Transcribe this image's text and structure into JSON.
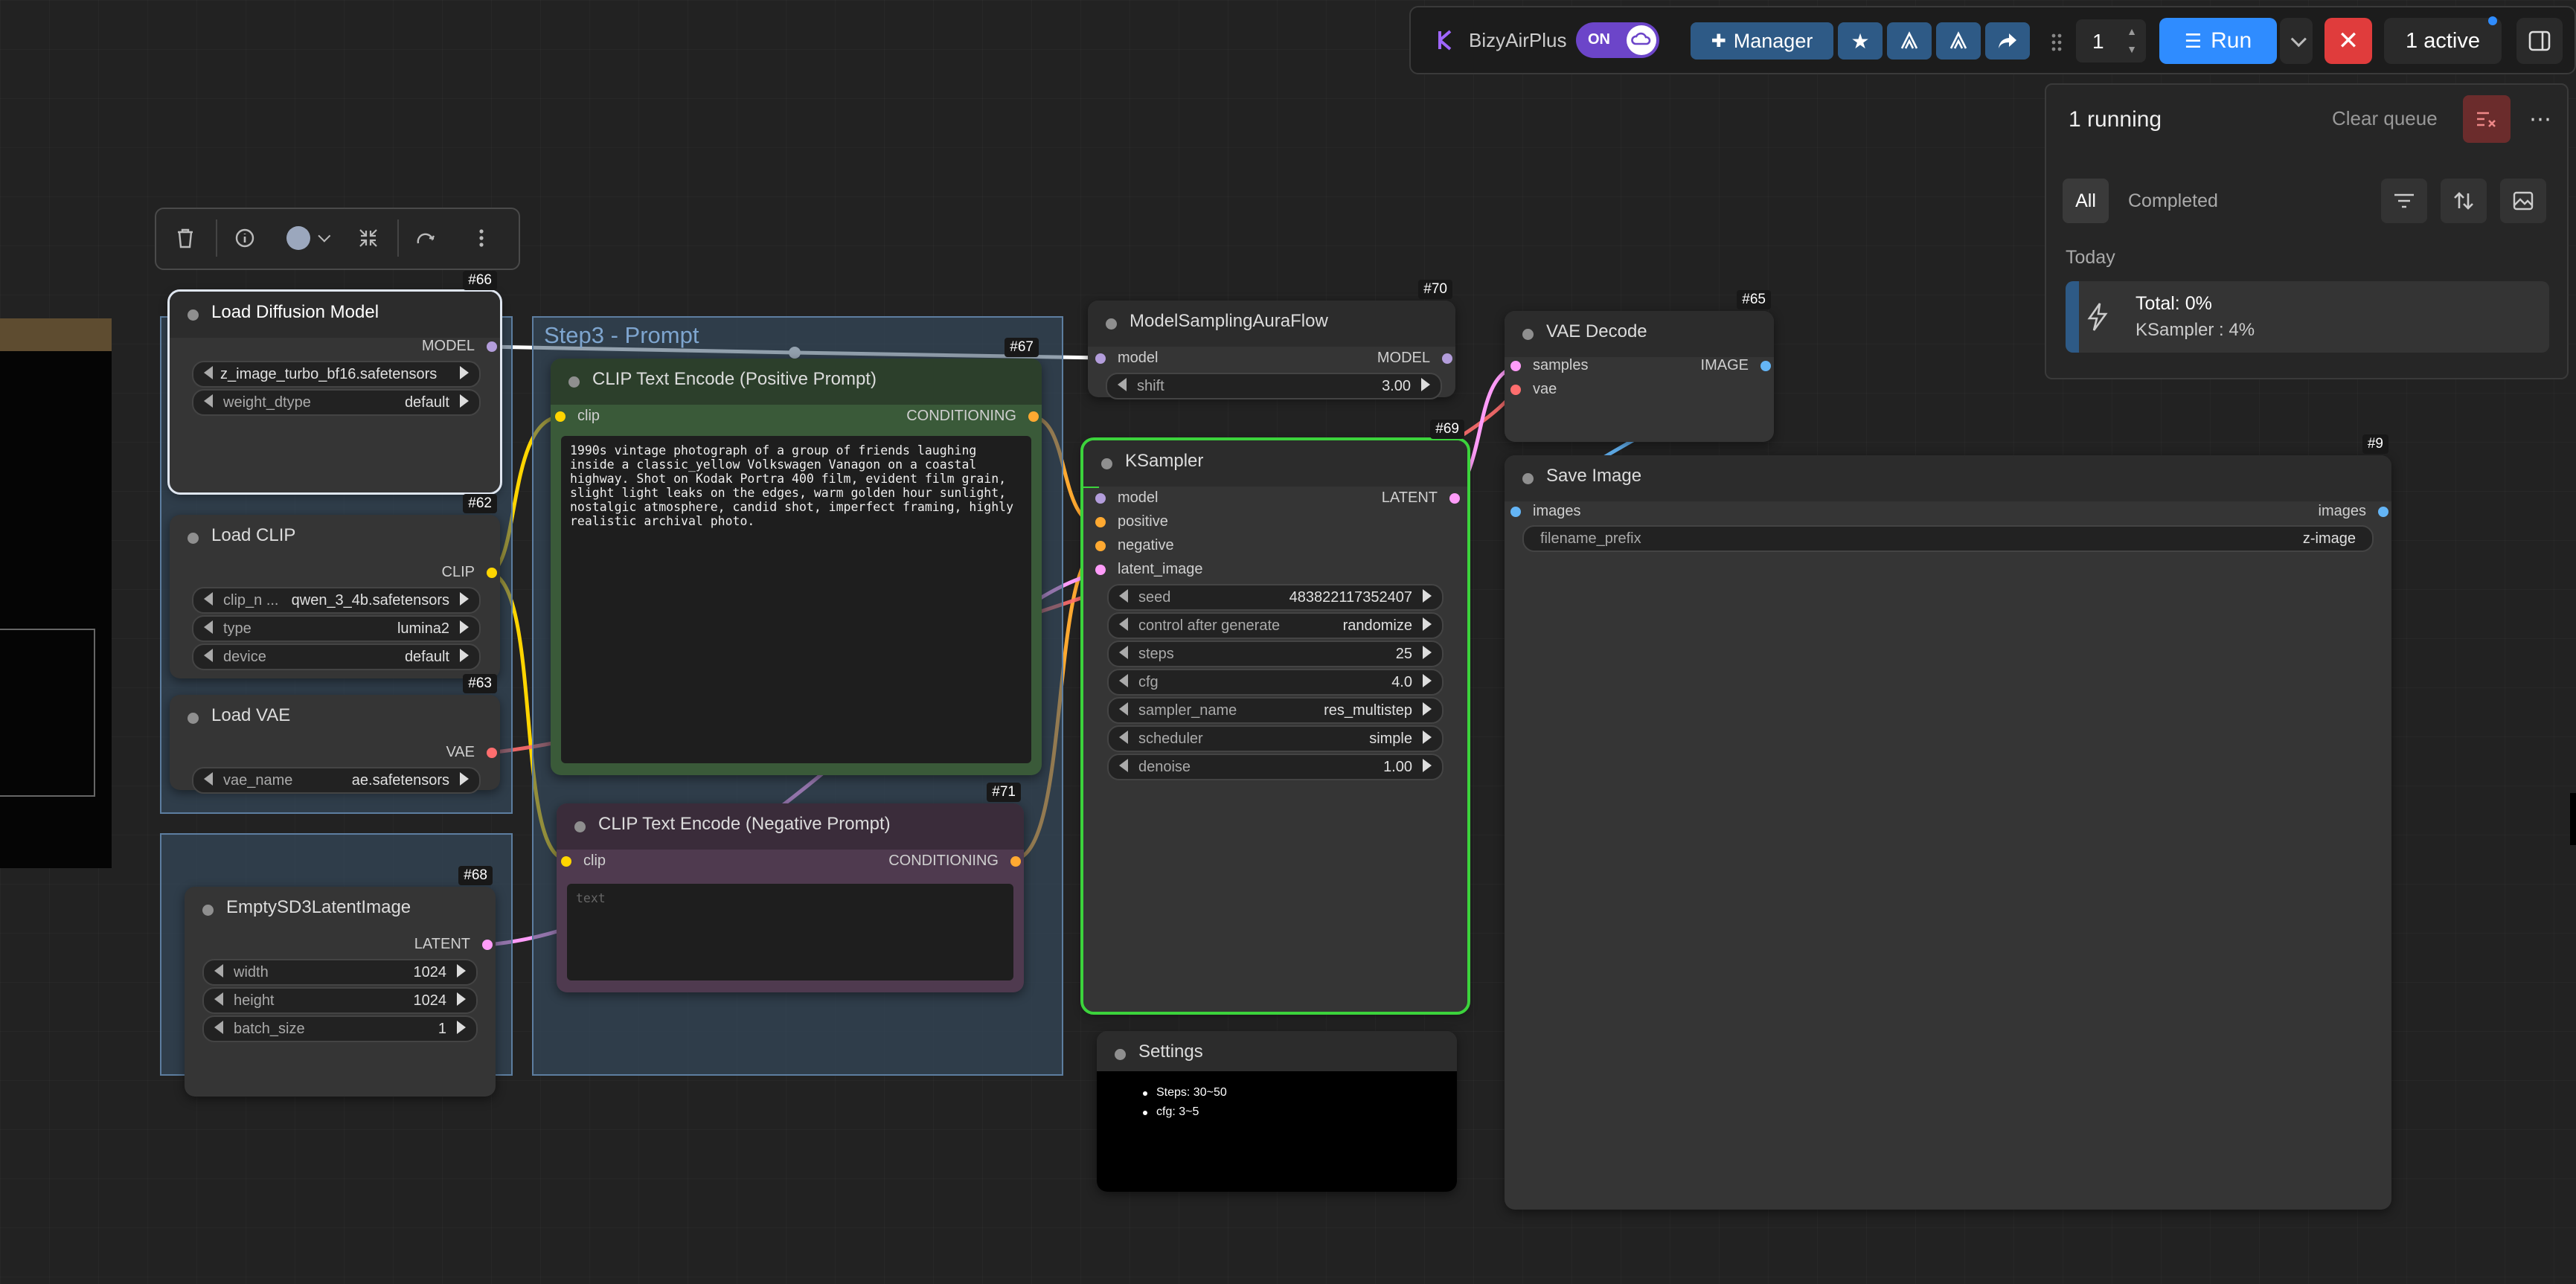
{
  "toolbar": {
    "extension_name": "BizyAirPlus",
    "toggle_label": "ON",
    "manager_label": "Manager",
    "batch_count": "1",
    "run_label": "Run",
    "active_label": "1 active"
  },
  "queue": {
    "running_label": "1 running",
    "clear_label": "Clear queue",
    "tab_all": "All",
    "tab_completed": "Completed",
    "section_today": "Today",
    "job_total": "Total: 0%",
    "job_sub": "KSampler : 4%",
    "progress_fraction": 0.04
  },
  "groups": {
    "step3_title": "Step3 - Prompt"
  },
  "nodes": {
    "load_diffusion": {
      "id": "#66",
      "title": "Load Diffusion Model",
      "out_model": "MODEL",
      "unet_name": "z_image_turbo_bf16.safetensors",
      "weight_dtype_label": "weight_dtype",
      "weight_dtype": "default"
    },
    "load_clip": {
      "id": "#62",
      "title": "Load CLIP",
      "out_clip": "CLIP",
      "clip_name_label": "clip_n ...",
      "clip_name": "qwen_3_4b.safetensors",
      "type_label": "type",
      "type": "lumina2",
      "device_label": "device",
      "device": "default"
    },
    "load_vae": {
      "id": "#63",
      "title": "Load VAE",
      "out_vae": "VAE",
      "vae_name_label": "vae_name",
      "vae_name": "ae.safetensors"
    },
    "empty_latent": {
      "id": "#68",
      "title": "EmptySD3LatentImage",
      "out_latent": "LATENT",
      "width_label": "width",
      "width": "1024",
      "height_label": "height",
      "height": "1024",
      "batch_label": "batch_size",
      "batch": "1"
    },
    "clip_pos": {
      "id": "#67",
      "title": "CLIP Text Encode (Positive Prompt)",
      "in_clip": "clip",
      "out_cond": "CONDITIONING",
      "text": "1990s vintage photograph of a group of friends laughing inside a classic_yellow Volkswagen Vanagon on a coastal highway. Shot on Kodak Portra 400 film, evident film grain, slight light leaks on the edges, warm golden hour sunlight, nostalgic atmosphere, candid shot, imperfect framing, highly realistic archival photo."
    },
    "clip_neg": {
      "id": "#71",
      "title": "CLIP Text Encode (Negative Prompt)",
      "in_clip": "clip",
      "out_cond": "CONDITIONING",
      "placeholder": "text"
    },
    "model_sampling": {
      "id": "#70",
      "title": "ModelSamplingAuraFlow",
      "in_model": "model",
      "out_model": "MODEL",
      "shift_label": "shift",
      "shift": "3.00"
    },
    "ksampler": {
      "id": "#69",
      "title": "KSampler",
      "in_model": "model",
      "in_positive": "positive",
      "in_negative": "negative",
      "in_latent": "latent_image",
      "out_latent": "LATENT",
      "seed_label": "seed",
      "seed": "483822117352407",
      "control_label": "control after generate",
      "control": "randomize",
      "steps_label": "steps",
      "steps": "25",
      "cfg_label": "cfg",
      "cfg": "4.0",
      "sampler_label": "sampler_name",
      "sampler": "res_multistep",
      "scheduler_label": "scheduler",
      "scheduler": "simple",
      "denoise_label": "denoise",
      "denoise": "1.00"
    },
    "vae_decode": {
      "id": "#65",
      "title": "VAE Decode",
      "in_samples": "samples",
      "in_vae": "vae",
      "out_image": "IMAGE"
    },
    "save_image": {
      "id": "#9",
      "title": "Save Image",
      "in_images": "images",
      "out_images": "images",
      "prefix_label": "filename_prefix",
      "prefix": "z-image"
    },
    "settings": {
      "title": "Settings",
      "note1": "Steps: 30~50",
      "note2": "cfg: 3~5"
    }
  },
  "colors": {
    "model": "#b39ddb",
    "clip": "#ffd500",
    "vae": "#ff6e6e",
    "conditioning": "#ffa931",
    "latent": "#ff9cf9",
    "image": "#64b5f6",
    "run_button": "#2f8cff",
    "cancel_button": "#e03c3c"
  },
  "icons": {
    "delete": "trash-icon",
    "info": "info-icon",
    "color": "color-circle-icon",
    "collapse": "collapse-icon",
    "bypass": "redo-icon",
    "more": "more-icon"
  }
}
